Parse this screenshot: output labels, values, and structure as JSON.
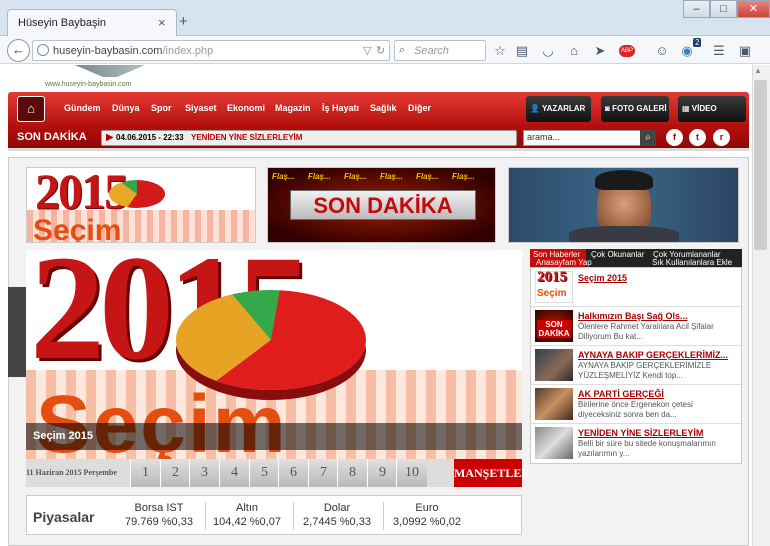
{
  "browser": {
    "tab_title": "Hüseyin Baybaşin",
    "tab_close": "×",
    "new_tab": "+",
    "url_host": "huseyin-baybasin.com",
    "url_path": "/index.php",
    "search_placeholder": "Search",
    "notification_count": "2",
    "abp_label": "ABP"
  },
  "site": {
    "logo_text": "www.huseyin-baybasin.com",
    "menu": [
      "Gündem",
      "Dünya",
      "Spor",
      "Siyaset",
      "Ekonomi",
      "Magazin",
      "İş Hayatı",
      "Sağlık",
      "Diğer"
    ],
    "buttons": {
      "yazarlar": "YAZARLAR",
      "foto": "FOTO GALERİ",
      "video": "VİDEO GALERİ"
    },
    "breaking_label": "SON DAKİKA",
    "breaking_date": "04.06.2015 - 22:33",
    "breaking_headline": "YENİDEN YİNE SİZLERLEYİM",
    "search_value": "arama...",
    "social": {
      "facebook": "f",
      "twitter": "t",
      "rss": "r"
    }
  },
  "banners": {
    "year": "2015",
    "secim": "Seçim",
    "son_dakika": "SON DAKİKA",
    "flash": "Flaş...",
    "site_colors": {
      "red": "#c70c0a",
      "dark": "#222222"
    }
  },
  "slider": {
    "caption": "Seçim 2015",
    "date": "11 Haziran 2015 Perşembe",
    "pages": [
      "1",
      "2",
      "3",
      "4",
      "5",
      "6",
      "7",
      "8",
      "9",
      "10"
    ],
    "mansetler": "MANŞETLER"
  },
  "sidebar": {
    "tabs": [
      "Son Haberler",
      "Çok Okunanlar",
      "Çok Yorumlananlar"
    ],
    "overlay_links": [
      "Anasayfam Yap",
      "Sık Kullanılanlara Ekle"
    ],
    "news": [
      {
        "title": "Seçim 2015",
        "summary": ""
      },
      {
        "title": "Halkımızın Başı Sağ Ols...",
        "summary": "Ölenlere Rahmet Yaralılara Acil Şifalar Diliyorum Bu kat..."
      },
      {
        "title": "AYNAYA BAKIP GERÇEKLERİMİZ...",
        "summary": "AYNAYA BAKIP GERÇEKLERİMİZLE YÜZLEŞMELİYİZ Kendi top..."
      },
      {
        "title": "AK PARTİ GERÇEĞİ",
        "summary": "Birilerine önce Ergenekon çetesi diyeceksiniz sonra ben da..."
      },
      {
        "title": "YENİDEN YİNE SİZLERLEYİM",
        "summary": "Belli bir süre bu sitede konuşmalarımın yazılarımın y..."
      }
    ]
  },
  "market": {
    "title": "Piyasalar",
    "items": [
      {
        "name": "Borsa IST",
        "value": "79.769 %0,33"
      },
      {
        "name": "Altın",
        "value": "104,42 %0,07"
      },
      {
        "name": "Dolar",
        "value": "2,7445 %0,33"
      },
      {
        "name": "Euro",
        "value": "3,0992 %0,02"
      }
    ]
  }
}
